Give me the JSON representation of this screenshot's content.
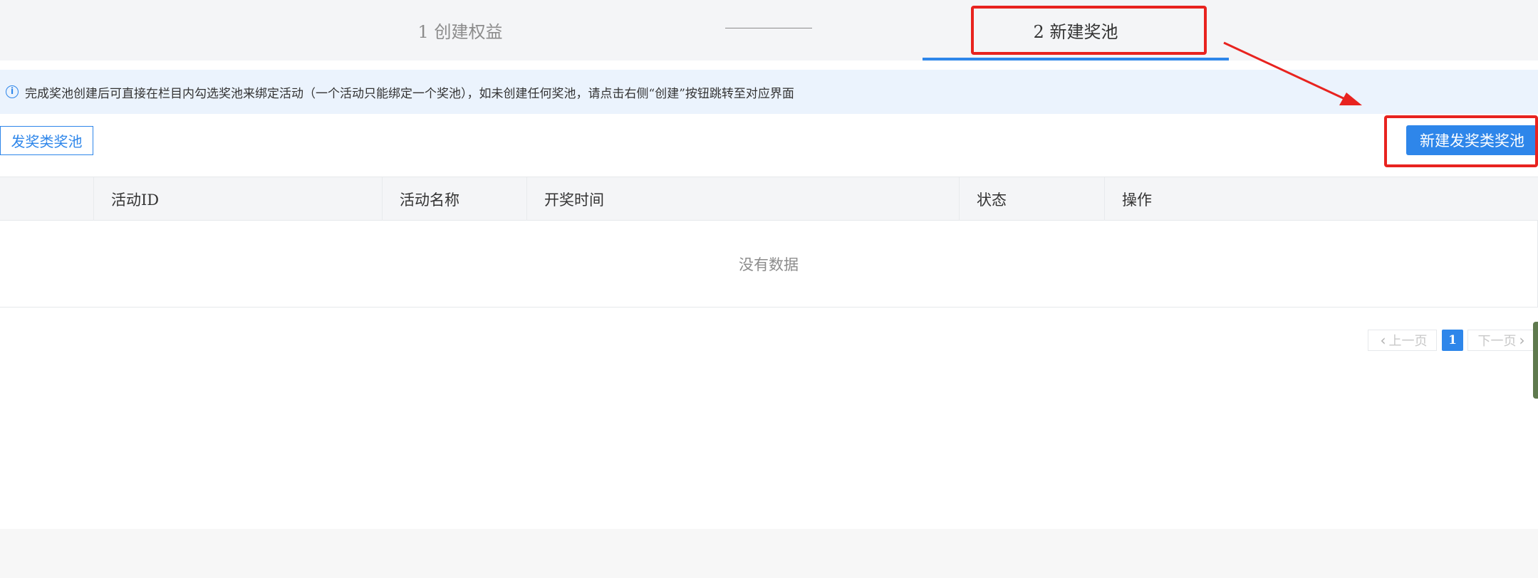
{
  "steps": {
    "step1": "1 创建权益",
    "step2": "2 新建奖池"
  },
  "info": {
    "icon": "info-icon",
    "text": "完成奖池创建后可直接在栏目内勾选奖池来绑定活动（一个活动只能绑定一个奖池），如未创建任何奖池，请点击右侧“创建”按钮跳转至对应界面"
  },
  "toolbar": {
    "pool_tab": "发奖类奖池",
    "new_pool_button": "新建发奖类奖池"
  },
  "table": {
    "columns": [
      "",
      "活动ID",
      "活动名称",
      "开奖时间",
      "状态",
      "操作"
    ],
    "empty_text": "没有数据"
  },
  "pagination": {
    "prev": "上一页",
    "current": "1",
    "next": "下一页"
  },
  "colors": {
    "accent": "#2e86ea",
    "annotation": "#e8231f"
  }
}
